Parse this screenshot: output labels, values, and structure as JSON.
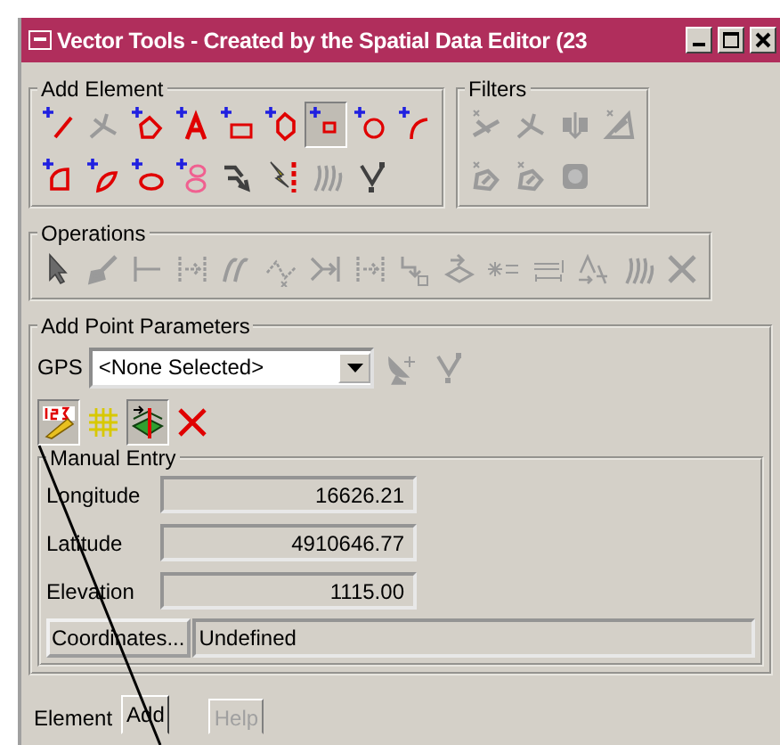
{
  "window": {
    "title": "Vector Tools - Created by the Spatial Data Editor (23"
  },
  "add_element": {
    "title": "Add Element",
    "rows": [
      [
        {
          "kind": "line",
          "selected": false,
          "disabled": false
        },
        {
          "kind": "network",
          "selected": false,
          "disabled": true
        },
        {
          "kind": "polygon",
          "selected": false,
          "disabled": false
        },
        {
          "kind": "text",
          "selected": false,
          "disabled": false
        },
        {
          "kind": "rectangle",
          "selected": false,
          "disabled": false
        },
        {
          "kind": "hexagon",
          "selected": false,
          "disabled": false
        },
        {
          "kind": "point",
          "selected": true,
          "disabled": false
        },
        {
          "kind": "circle",
          "selected": false,
          "disabled": false
        },
        {
          "kind": "arc",
          "selected": false,
          "disabled": false
        }
      ],
      [
        {
          "kind": "sector",
          "selected": false,
          "disabled": false
        },
        {
          "kind": "leaf",
          "selected": false,
          "disabled": false
        },
        {
          "kind": "ellipse",
          "selected": false,
          "disabled": false
        },
        {
          "kind": "stack",
          "selected": false,
          "disabled": false
        },
        {
          "kind": "arrows",
          "selected": false,
          "disabled": false
        },
        {
          "kind": "lightning",
          "selected": false,
          "disabled": false
        },
        {
          "kind": "curves",
          "selected": false,
          "disabled": true
        },
        {
          "kind": "nodes",
          "selected": false,
          "disabled": false
        }
      ]
    ]
  },
  "filters": {
    "title": "Filters",
    "rows": [
      [
        {
          "kind": "x-line",
          "disabled": true
        },
        {
          "kind": "x-network",
          "disabled": true
        },
        {
          "kind": "merge",
          "disabled": true
        },
        {
          "kind": "x-angle",
          "disabled": true
        }
      ],
      [
        {
          "kind": "x-polygon",
          "disabled": true
        },
        {
          "kind": "x-polygon",
          "disabled": true
        },
        {
          "kind": "texture",
          "disabled": true
        }
      ]
    ]
  },
  "operations": {
    "title": "Operations",
    "tools": [
      {
        "kind": "pointer",
        "disabled": false
      },
      {
        "kind": "brush",
        "disabled": true
      },
      {
        "kind": "segment",
        "disabled": true
      },
      {
        "kind": "split",
        "disabled": true
      },
      {
        "kind": "slashes",
        "disabled": true
      },
      {
        "kind": "vertex",
        "disabled": true
      },
      {
        "kind": "extend",
        "disabled": true
      },
      {
        "kind": "split",
        "disabled": true
      },
      {
        "kind": "route",
        "disabled": true
      },
      {
        "kind": "move",
        "disabled": true
      },
      {
        "kind": "star",
        "disabled": true
      },
      {
        "kind": "bar",
        "disabled": true
      },
      {
        "kind": "triangle-move",
        "disabled": true
      },
      {
        "kind": "waves",
        "disabled": true
      },
      {
        "kind": "delete",
        "disabled": true
      }
    ]
  },
  "point_parameters": {
    "title": "Add Point Parameters",
    "gps_label": "GPS",
    "gps_value": "<None Selected>",
    "gps_tools": [
      {
        "kind": "dish",
        "disabled": true
      },
      {
        "kind": "nodes",
        "disabled": true
      }
    ],
    "tools": [
      {
        "kind": "numbers",
        "selected": true
      },
      {
        "kind": "grid",
        "selected": false
      },
      {
        "kind": "map",
        "selected": true
      },
      {
        "kind": "delete-red",
        "selected": false
      }
    ],
    "manual_entry": {
      "title": "Manual Entry",
      "fields": [
        {
          "label": "Longitude",
          "value": "16626.21"
        },
        {
          "label": "Latitude",
          "value": "4910646.77"
        },
        {
          "label": "Elevation",
          "value": "1115.00"
        }
      ]
    },
    "coordinates_button": "Coordinates...",
    "coordinates_value": "Undefined"
  },
  "tabs": [
    {
      "label": "Element",
      "selected": false,
      "disabled": false
    },
    {
      "label": "Add",
      "selected": true,
      "disabled": false
    },
    {
      "label": "Help",
      "selected": false,
      "disabled": true
    }
  ]
}
